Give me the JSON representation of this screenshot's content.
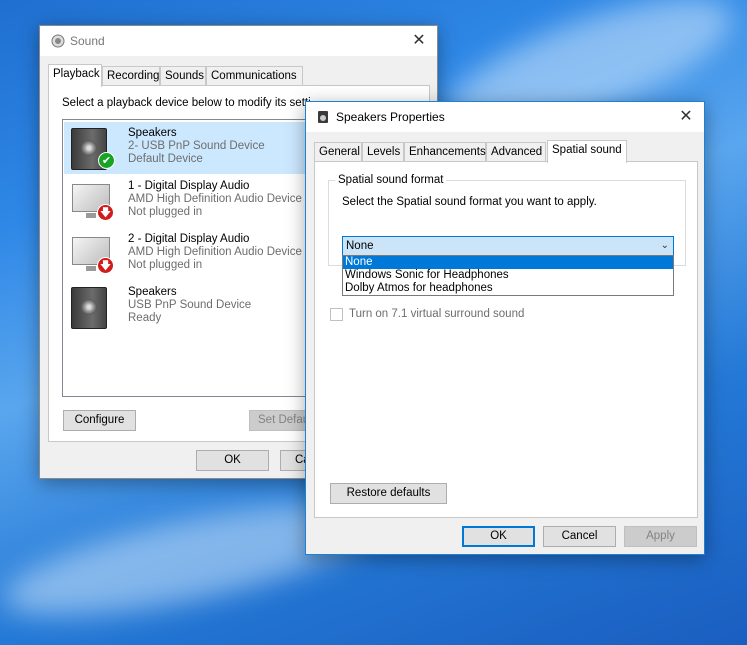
{
  "sound_dialog": {
    "title": "Sound",
    "tabs": [
      {
        "label": "Playback"
      },
      {
        "label": "Recording"
      },
      {
        "label": "Sounds"
      },
      {
        "label": "Communications"
      }
    ],
    "instruction": "Select a playback device below to modify its setti",
    "devices": [
      {
        "name": "Speakers",
        "line1": "2- USB PnP Sound Device",
        "line2": "Default Device",
        "status": "default"
      },
      {
        "name": "1 - Digital Display Audio",
        "line1": "AMD High Definition Audio Device",
        "line2": "Not plugged in",
        "status": "unplugged"
      },
      {
        "name": "2 - Digital Display Audio",
        "line1": "AMD High Definition Audio Device",
        "line2": "Not plugged in",
        "status": "unplugged"
      },
      {
        "name": "Speakers",
        "line1": "USB PnP Sound Device",
        "line2": "Ready",
        "status": "ready"
      }
    ],
    "configure_label": "Configure",
    "set_default_label": "Set Defau",
    "ok_label": "OK",
    "cancel_label": "Ca"
  },
  "properties_dialog": {
    "title": "Speakers Properties",
    "tabs": [
      {
        "label": "General"
      },
      {
        "label": "Levels"
      },
      {
        "label": "Enhancements"
      },
      {
        "label": "Advanced"
      },
      {
        "label": "Spatial sound"
      }
    ],
    "group_title": "Spatial sound format",
    "instruction": "Select the Spatial sound format you want to apply.",
    "selected_value": "None",
    "options": [
      "None",
      "Windows Sonic for Headphones",
      "Dolby Atmos for headphones"
    ],
    "surround_label": "Turn on 7.1 virtual surround sound",
    "restore_label": "Restore defaults",
    "ok_label": "OK",
    "cancel_label": "Cancel",
    "apply_label": "Apply"
  }
}
